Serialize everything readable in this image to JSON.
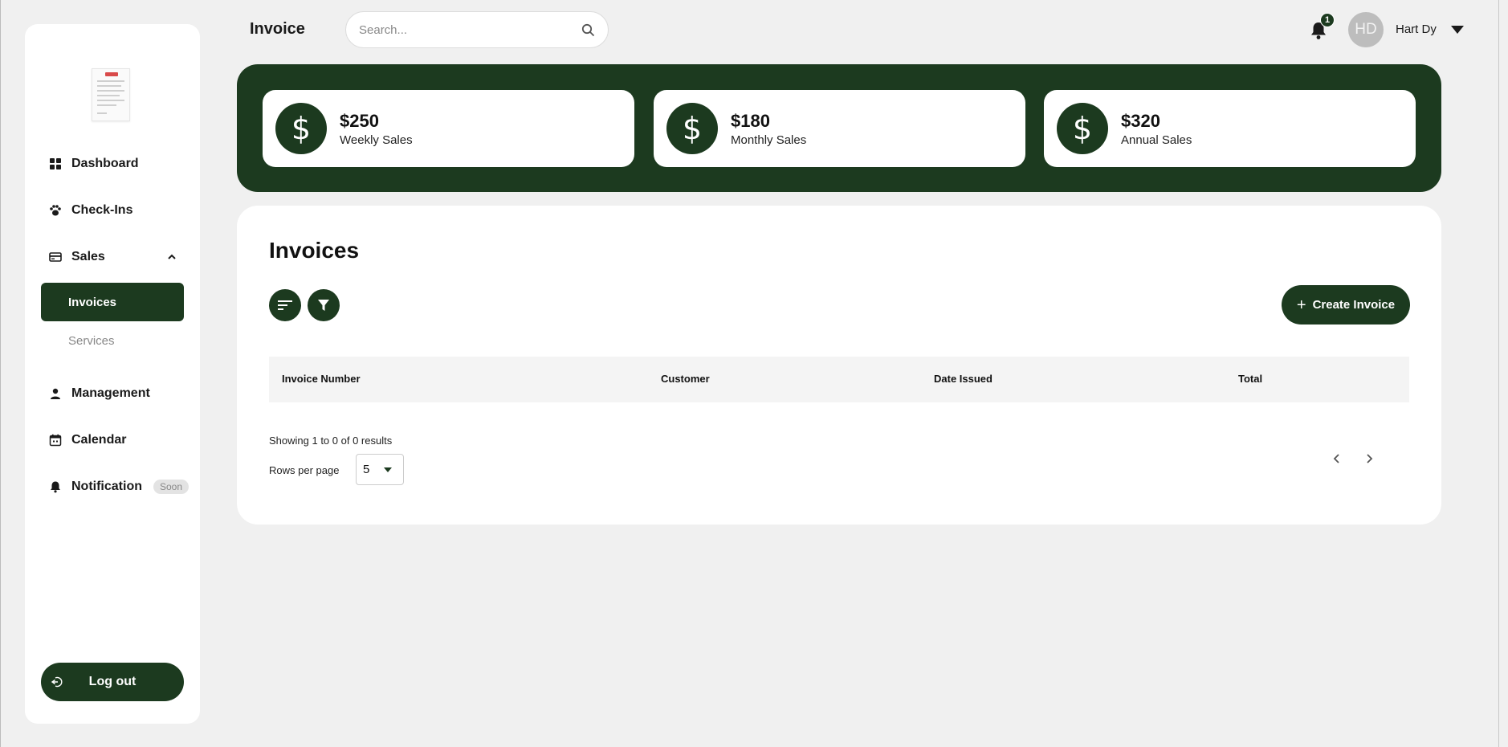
{
  "header": {
    "title": "Invoice",
    "search_placeholder": "Search...",
    "notification_count": "1",
    "user_initials": "HD",
    "user_name": "Hart Dy"
  },
  "sidebar": {
    "items": [
      {
        "label": "Dashboard",
        "icon": "grid-icon"
      },
      {
        "label": "Check-Ins",
        "icon": "paw-icon"
      },
      {
        "label": "Sales",
        "icon": "card-icon",
        "expanded": true
      },
      {
        "label": "Management",
        "icon": "person-icon"
      },
      {
        "label": "Calendar",
        "icon": "calendar-icon"
      },
      {
        "label": "Notification",
        "icon": "bell-icon",
        "badge": "Soon"
      }
    ],
    "sales_sub": [
      {
        "label": "Invoices",
        "active": true
      },
      {
        "label": "Services",
        "active": false
      }
    ],
    "logout_label": "Log out"
  },
  "stats": [
    {
      "value": "$250",
      "label": "Weekly Sales",
      "icon": "$"
    },
    {
      "value": "$180",
      "label": "Monthly Sales",
      "icon": "$"
    },
    {
      "value": "$320",
      "label": "Annual Sales",
      "icon": "$"
    }
  ],
  "invoices": {
    "title": "Invoices",
    "create_label": "Create Invoice",
    "columns": [
      "Invoice Number",
      "Customer",
      "Date Issued",
      "Total"
    ],
    "rows": [],
    "showing": "Showing 1 to 0 of 0 results",
    "rows_per_page_label": "Rows per page",
    "rows_per_page_value": "5"
  },
  "colors": {
    "accent": "#1c3a1f",
    "background": "#f0f0f0",
    "card": "#ffffff"
  }
}
